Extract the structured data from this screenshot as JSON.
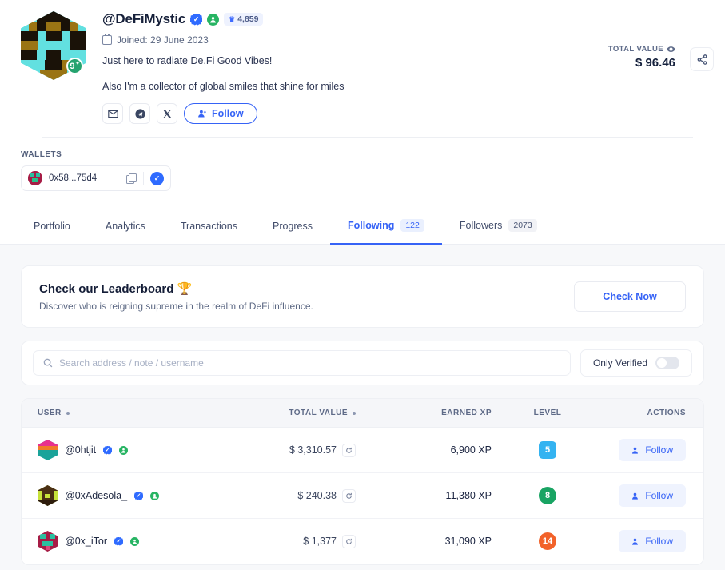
{
  "profile": {
    "username": "@DeFiMystic",
    "verified_icon": "verified-check-icon",
    "member_icon": "member-badge-icon",
    "trophy_glyph": "♛",
    "trophy_points": "4,859",
    "avatar_level": "9",
    "avatar_level_sup": "✦",
    "joined_label": "Joined: 29 June 2023",
    "bio_line1": "Just here to radiate De.Fi Good Vibes!",
    "bio_line2": "Also I'm a collector of global smiles that shine for miles",
    "follow_label": "Follow",
    "social": [
      {
        "name": "email-icon",
        "label": "Email"
      },
      {
        "name": "telegram-icon",
        "label": "Telegram"
      },
      {
        "name": "twitter-x-icon",
        "label": "X"
      }
    ],
    "total_value_label": "TOTAL VALUE",
    "total_value_amount": "$ 96.46",
    "share_icon": "share-icon"
  },
  "wallets": {
    "section_label": "WALLETS",
    "address": "0x58...75d4",
    "copy_icon": "copy-icon",
    "verified_icon": "wallet-verified-icon"
  },
  "tabs": [
    {
      "label": "Portfolio",
      "count": null,
      "active": false
    },
    {
      "label": "Analytics",
      "count": null,
      "active": false
    },
    {
      "label": "Transactions",
      "count": null,
      "active": false
    },
    {
      "label": "Progress",
      "count": null,
      "active": false
    },
    {
      "label": "Following",
      "count": "122",
      "active": true
    },
    {
      "label": "Followers",
      "count": "2073",
      "active": false
    }
  ],
  "leaderboard": {
    "title": "Check our Leaderboard 🏆",
    "subtitle": "Discover who is reigning supreme in the realm of DeFi influence.",
    "button_label": "Check Now"
  },
  "filters": {
    "search_placeholder": "Search address / note / username",
    "search_value": "",
    "search_icon": "search-icon",
    "only_verified_label": "Only Verified",
    "only_verified_on": false
  },
  "table": {
    "columns": [
      {
        "label": "USER",
        "sortable": true
      },
      {
        "label": "TOTAL VALUE",
        "sortable": true
      },
      {
        "label": "EARNED XP",
        "sortable": false
      },
      {
        "label": "LEVEL",
        "sortable": false
      },
      {
        "label": "ACTIONS",
        "sortable": false
      }
    ],
    "follow_label": "Follow",
    "rows": [
      {
        "username": "@0htjit",
        "total_value": "$ 3,310.57",
        "earned_xp": "6,900 XP",
        "level": "5",
        "level_color": "#34b3f1",
        "level_shape": "square",
        "avatar_colors": [
          "#1aa39a",
          "#e8318f",
          "#f07a2a"
        ]
      },
      {
        "username": "@0xAdesola_",
        "total_value": "$ 240.38",
        "earned_xp": "11,380 XP",
        "level": "8",
        "level_color": "#19a463",
        "level_shape": "circle",
        "avatar_colors": [
          "#5c3a1a",
          "#c7e23a",
          "#2e1c0c"
        ]
      },
      {
        "username": "@0x_iTor",
        "total_value": "$ 1,377",
        "earned_xp": "31,090 XP",
        "level": "14",
        "level_color": "#f2622a",
        "level_shape": "circle",
        "avatar_colors": [
          "#a61c45",
          "#2bbfa0",
          "#e0457b"
        ]
      }
    ]
  },
  "colors": {
    "accent": "#3663f6",
    "page_bg": "#f7f8fa",
    "card_bg": "#ffffff",
    "verified_blue": "#2f6bff",
    "member_green": "#27b463"
  }
}
